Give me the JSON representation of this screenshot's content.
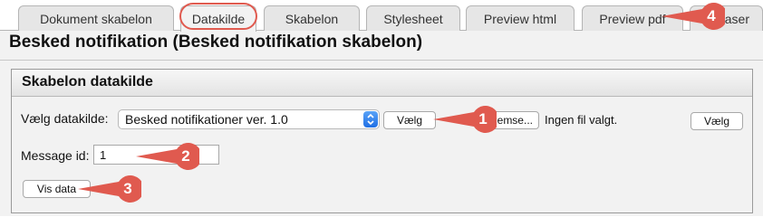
{
  "tabs": [
    {
      "label": "Dokument skabelon"
    },
    {
      "label": "Datakilde"
    },
    {
      "label": "Skabelon"
    },
    {
      "label": "Stylesheet"
    },
    {
      "label": "Preview html"
    },
    {
      "label": "Preview pdf"
    },
    {
      "label": "aser"
    }
  ],
  "active_tab": "Datakilde",
  "page": {
    "title": "Besked notifikation (Besked notifikation skabelon)"
  },
  "section": {
    "title": "Skabelon datakilde",
    "datasource_label": "Vælg datakilde:",
    "datasource_value": "Besked notifikationer ver. 1.0",
    "choose_button": "Vælg",
    "file_button": "emse...",
    "no_file_text": "Ingen fil valgt.",
    "choose_button_2": "Vælg",
    "message_id_label": "Message id:",
    "message_id_value": "1",
    "show_data_button": "Vis data"
  },
  "callouts": [
    "1",
    "2",
    "3",
    "4"
  ],
  "colors": {
    "callout": "#e05a4f",
    "select_arrow": "#2f7ff0",
    "panel_bg": "#f2f2f2",
    "tab_bg": "#e6e6e6"
  }
}
